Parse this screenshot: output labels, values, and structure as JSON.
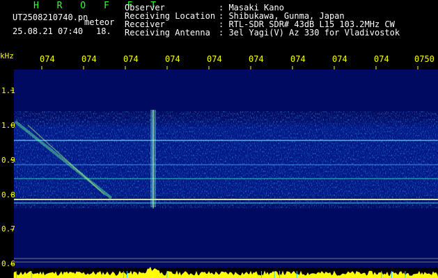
{
  "header": {
    "brand": "H R O F F T",
    "filename": "UT2508210740.pn",
    "tag": "meteor",
    "date_time": "25.08.21 07:40",
    "number": "18."
  },
  "meta": [
    {
      "key": "Observer",
      "value": ": Masaki Kano"
    },
    {
      "key": "Receiving Location",
      "value": ": Shibukawa, Gunma, Japan"
    },
    {
      "key": "Receiver",
      "value": ": RTL-SDR SDR# 43dB L15 103.2MHz CW"
    },
    {
      "key": "Receiving Antenna",
      "value": ": 3el Yagi(V) Az 330 for Vladivostok"
    }
  ],
  "axis": {
    "unit": "kHz",
    "time_ticks": [
      "074",
      "074",
      "074",
      "074",
      "074",
      "074",
      "074",
      "074",
      "074",
      "0750"
    ],
    "freq_ticks": [
      "1.1",
      "1.0",
      "0.9",
      "0.8",
      "0.7",
      "0.6"
    ]
  },
  "colors": {
    "background": "#000000",
    "brand": "#33ff33",
    "axis_text": "#ffff00",
    "plot_bg": "#000a60"
  }
}
